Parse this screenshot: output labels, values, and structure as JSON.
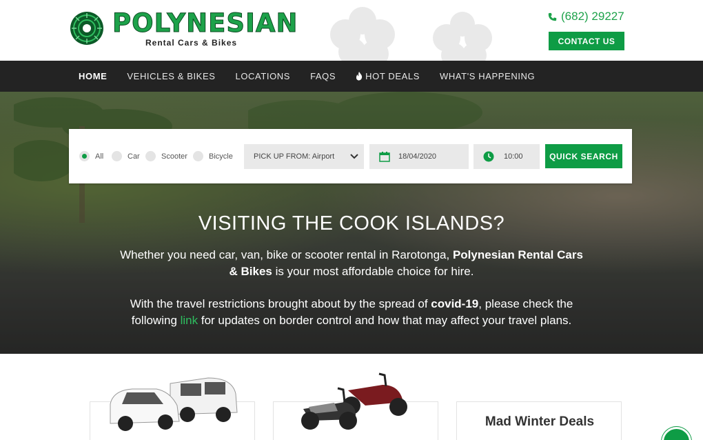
{
  "header": {
    "logo_text": "Polynesian",
    "logo_subtitle": "Rental Cars & Bikes",
    "phone": "(682) 29227",
    "contact_label": "CONTACT US"
  },
  "nav": {
    "items": [
      {
        "label": "HOME",
        "active": true
      },
      {
        "label": "VEHICLES & BIKES"
      },
      {
        "label": "LOCATIONS"
      },
      {
        "label": "FAQS"
      },
      {
        "label": "HOT DEALS",
        "icon": "flame-icon"
      },
      {
        "label": "WHAT'S HAPPENING"
      }
    ]
  },
  "search": {
    "types": [
      {
        "label": "All",
        "selected": true
      },
      {
        "label": "Car"
      },
      {
        "label": "Scooter"
      },
      {
        "label": "Bicycle"
      }
    ],
    "pickup": "PICK UP FROM: Airport",
    "date": "18/04/2020",
    "time": "10:00",
    "button": "QUICK SEARCH"
  },
  "hero": {
    "title": "VISITING THE COOK ISLANDS?",
    "p1_a": "Whether you need car, van, bike or scooter rental in Rarotonga, ",
    "p1_b": "Polynesian Rental Cars & Bikes",
    "p1_c": " is your most affordable choice for hire.",
    "p2_a": "With the travel restrictions brought about by the spread of ",
    "p2_b": "covid-19",
    "p2_c": ", please check the following ",
    "p2_link": "link",
    "p2_d": " for updates on border control and how that may affect your travel plans."
  },
  "cards": {
    "deals_title": "Mad Winter Deals"
  },
  "colors": {
    "brand_green": "#0e9c45",
    "nav_bg": "#232323"
  }
}
